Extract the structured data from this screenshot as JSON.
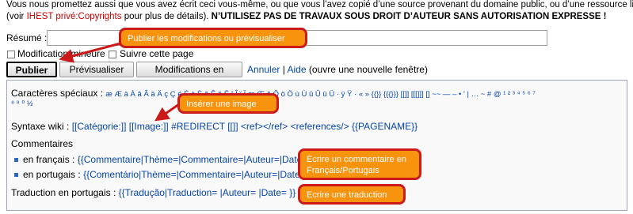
{
  "notice": {
    "line1": "Vous nous promettez aussi que vous avez écrit ceci vous-même, ou que vous l’avez copié d’une source provenant du domaine public, ou d’une ressource libre.",
    "line2_prefix": "(voir ",
    "line2_link": "IHEST privé:Copyrights",
    "line2_middle": " pour plus de détails). ",
    "line2_bold": "N’UTILISEZ PAS DE TRAVAUX SOUS DROIT D’AUTEUR SANS AUTORISATION EXPRESSE !"
  },
  "summary": {
    "label": "Résumé :",
    "value": ""
  },
  "checkboxes": [
    {
      "label": "Modification mineure",
      "checked": false
    },
    {
      "label": "Suivre cette page",
      "checked": false
    }
  ],
  "buttons": {
    "publish": "Publier",
    "preview": "Prévisualiser",
    "changes": "Modifications en cours"
  },
  "links": {
    "cancel": "Annuler",
    "separator": " | ",
    "help": "Aide",
    "help_suffix": " (ouvre une nouvelle fenêtre)"
  },
  "special_chars": {
    "label": "Caractères spéciaux :",
    "chars": "æ Æ à À â Â ä Ä ç Ç é É è È ê Ê ë Ë î Î ï Ï œ Œ ô Ô ö Ö ù Ù û Û ü Ü · ÿ Ÿ · « » {{}} {{{}}} [[]] [[[]]] [] ~~ — – • ' | … ~ # @ ¹ ² ³ ⁴ ⁵ ⁶ ⁷",
    "chars_line2": "⁸ ⁹ ⁰ ½"
  },
  "wiki_syntax": {
    "label": "Syntaxe wiki :",
    "items": "[[Catégorie:]] [[Image:]] #REDIRECT [[]] <ref></ref> <references/> {{PAGENAME}}"
  },
  "comments": {
    "heading": "Commentaires",
    "fr_label": "en français :",
    "fr_template": "{{Commentaire|Thème=|Commentaire=|Auteur=|Date=}}",
    "pt_label": "en portugais :",
    "pt_template": "{{Comentário|Thème=|Commentaire=|Auteur=|Date=}}"
  },
  "translation": {
    "label": "Traduction en portugais :",
    "template": "{{Tradução|Traduction= |Auteur= |Date= }}"
  },
  "callouts": {
    "publish": "Publier les modifications ou prévisualiser",
    "image": "Insérer une image",
    "comment": "Ecrire un commentaire en Français/Portugais",
    "translation": "Ecrire une traduction"
  },
  "colors": {
    "callout_fill": "#f8930e",
    "callout_border": "#cc1a1a",
    "link": "#0645ad",
    "copyright_link": "#cc0000"
  }
}
